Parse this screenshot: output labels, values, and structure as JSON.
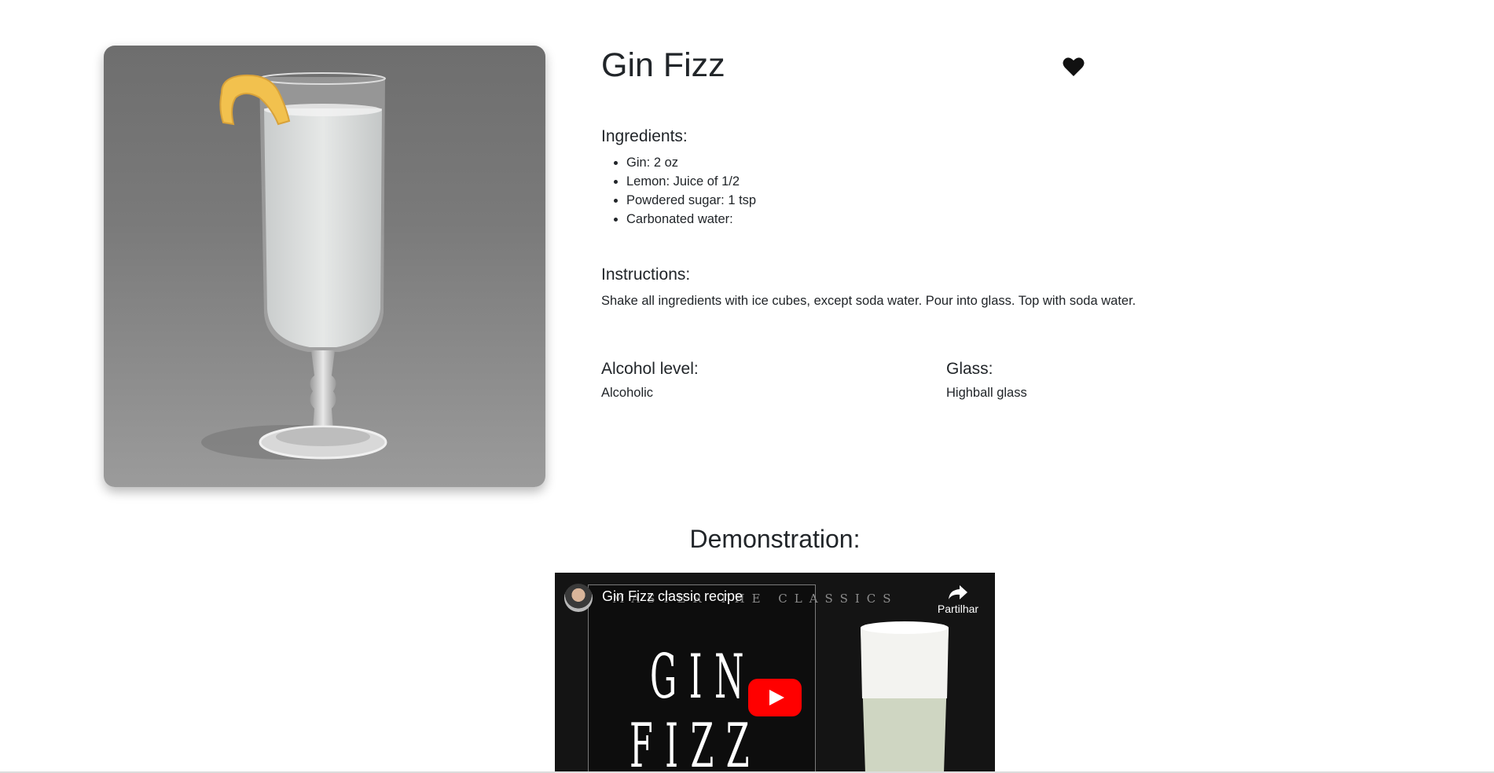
{
  "drink": {
    "name": "Gin Fizz",
    "image_alt": "Gin Fizz cocktail in a glass with lemon peel"
  },
  "favorite": {
    "icon": "heart-icon",
    "state": "favorited"
  },
  "ingredients": {
    "heading": "Ingredients:",
    "items": [
      "Gin: 2 oz",
      "Lemon: Juice of 1/2",
      "Powdered sugar: 1 tsp",
      "Carbonated water:"
    ]
  },
  "instructions": {
    "heading": "Instructions:",
    "text": "Shake all ingredients with ice cubes, except soda water. Pour into glass. Top with soda water."
  },
  "alcohol": {
    "heading": "Alcohol level:",
    "value": "Alcoholic"
  },
  "glass": {
    "heading": "Glass:",
    "value": "Highball glass"
  },
  "demonstration": {
    "heading": "Demonstration:",
    "video": {
      "title": "Gin Fizz classic recipe",
      "share_label": "Partilhar",
      "poster_top_text": "MASTER THE CLASSICS",
      "poster_words": [
        "GIN",
        "FIZZ"
      ],
      "play_color": "#ff0000"
    }
  },
  "colors": {
    "text": "#212529",
    "background": "#ffffff"
  }
}
